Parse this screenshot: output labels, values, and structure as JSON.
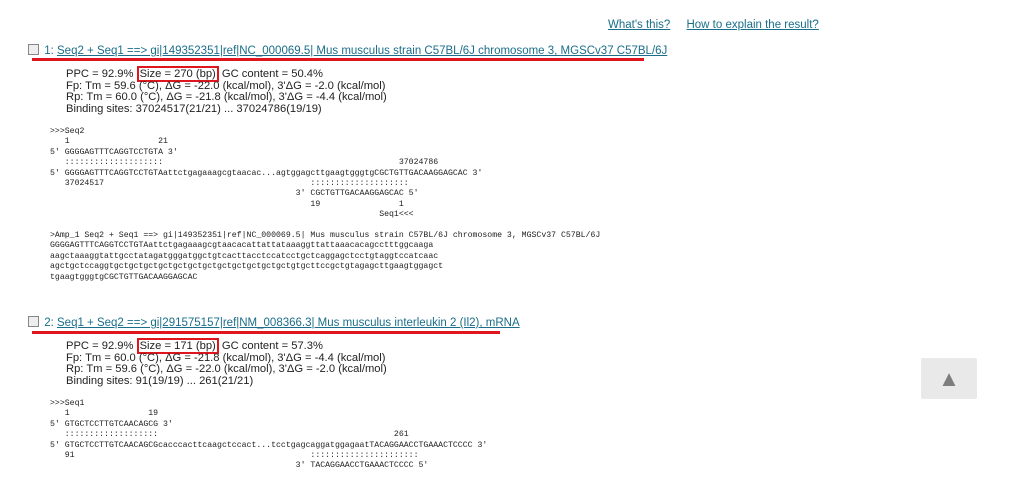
{
  "toplinks": {
    "whats_this": "What's this?",
    "explain": "How to explain the result?"
  },
  "results": [
    {
      "num": "1:",
      "title": "Seq2 + Seq1 ==> gi|149352351|ref|NC_000069.5| Mus musculus strain C57BL/6J chromosome 3, MGSCv37 C57BL/6J",
      "ppc": "PPC = 92.9%",
      "size": "Size = 270 (bp)",
      "gc": "GC content = 50.4%",
      "fp": "Fp: Tm = 59.6 (°C), ΔG = -22.0 (kcal/mol), 3'ΔG = -2.0 (kcal/mol)",
      "rp": "Rp: Tm = 60.0 (°C), ΔG = -21.8 (kcal/mol), 3'ΔG = -4.4 (kcal/mol)",
      "binding": "Binding sites: 37024517(21/21) ... 37024786(19/19)",
      "alignment": ">>>Seq2\n   1                  21\n5' GGGGAGTTTCAGGTCCTGTA 3'\n   ::::::::::::::::::::                                                37024786\n5' GGGGAGTTTCAGGTCCTGTAattctgagaaagcgtaacac...agtggagcttgaagtgggtgCGCTGTTGACAAGGAGCAC 3'\n   37024517                                          ::::::::::::::::::::\n                                                  3' CGCTGTTGACAAGGAGCAC 5'\n                                                     19                1\n                                                                   Seq1<<<\n\n>Amp_1 Seq2 + Seq1 ==> gi|149352351|ref|NC_000069.5| Mus musculus strain C57BL/6J chromosome 3, MGSCv37 C57BL/6J\nGGGGAGTTTCAGGTCCTGTAattctgagaaagcgtaacacattattataaaggttattaaacacagcctttggcaaga\naagctaaaggtattgcctatagatgggatggctgtcacttacctccatcctgctcaggagctcctgtaggtccatcaac\nagctgctccaggtgctgctgctgctgctgctgctgctgctgctgctgctgtgcttccgctgtagagcttgaagtggagct\ntgaagtgggtgCGCTGTTGACAAGGAGCAC"
    },
    {
      "num": "2:",
      "title": "Seq1 + Seq2 ==> gi|291575157|ref|NM_008366.3| Mus musculus interleukin 2 (Il2), mRNA",
      "ppc": "PPC = 92.9%",
      "size": "Size = 171 (bp)",
      "gc": "GC content = 57.3%",
      "fp": "Fp: Tm = 60.0 (°C), ΔG = -21.8 (kcal/mol), 3'ΔG = -4.4 (kcal/mol)",
      "rp": "Rp: Tm = 59.6 (°C), ΔG = -22.0 (kcal/mol), 3'ΔG = -2.0 (kcal/mol)",
      "binding": "Binding sites: 91(19/19) ... 261(21/21)",
      "alignment": ">>>Seq1\n   1                19\n5' GTGCTCCTTGTCAACAGCG 3'\n   :::::::::::::::::::                                                261\n5' GTGCTCCTTGTCAACAGCGcacccacttcaagctccact...tcctgagcaggatggagaatTACAGGAACCTGAAACTCCCC 3'\n   91                                                ::::::::::::::::::::::\n                                                  3' TACAGGAACCTGAAACTCCCC 5'"
    }
  ],
  "scroll_top": {
    "glyph": "▲"
  }
}
